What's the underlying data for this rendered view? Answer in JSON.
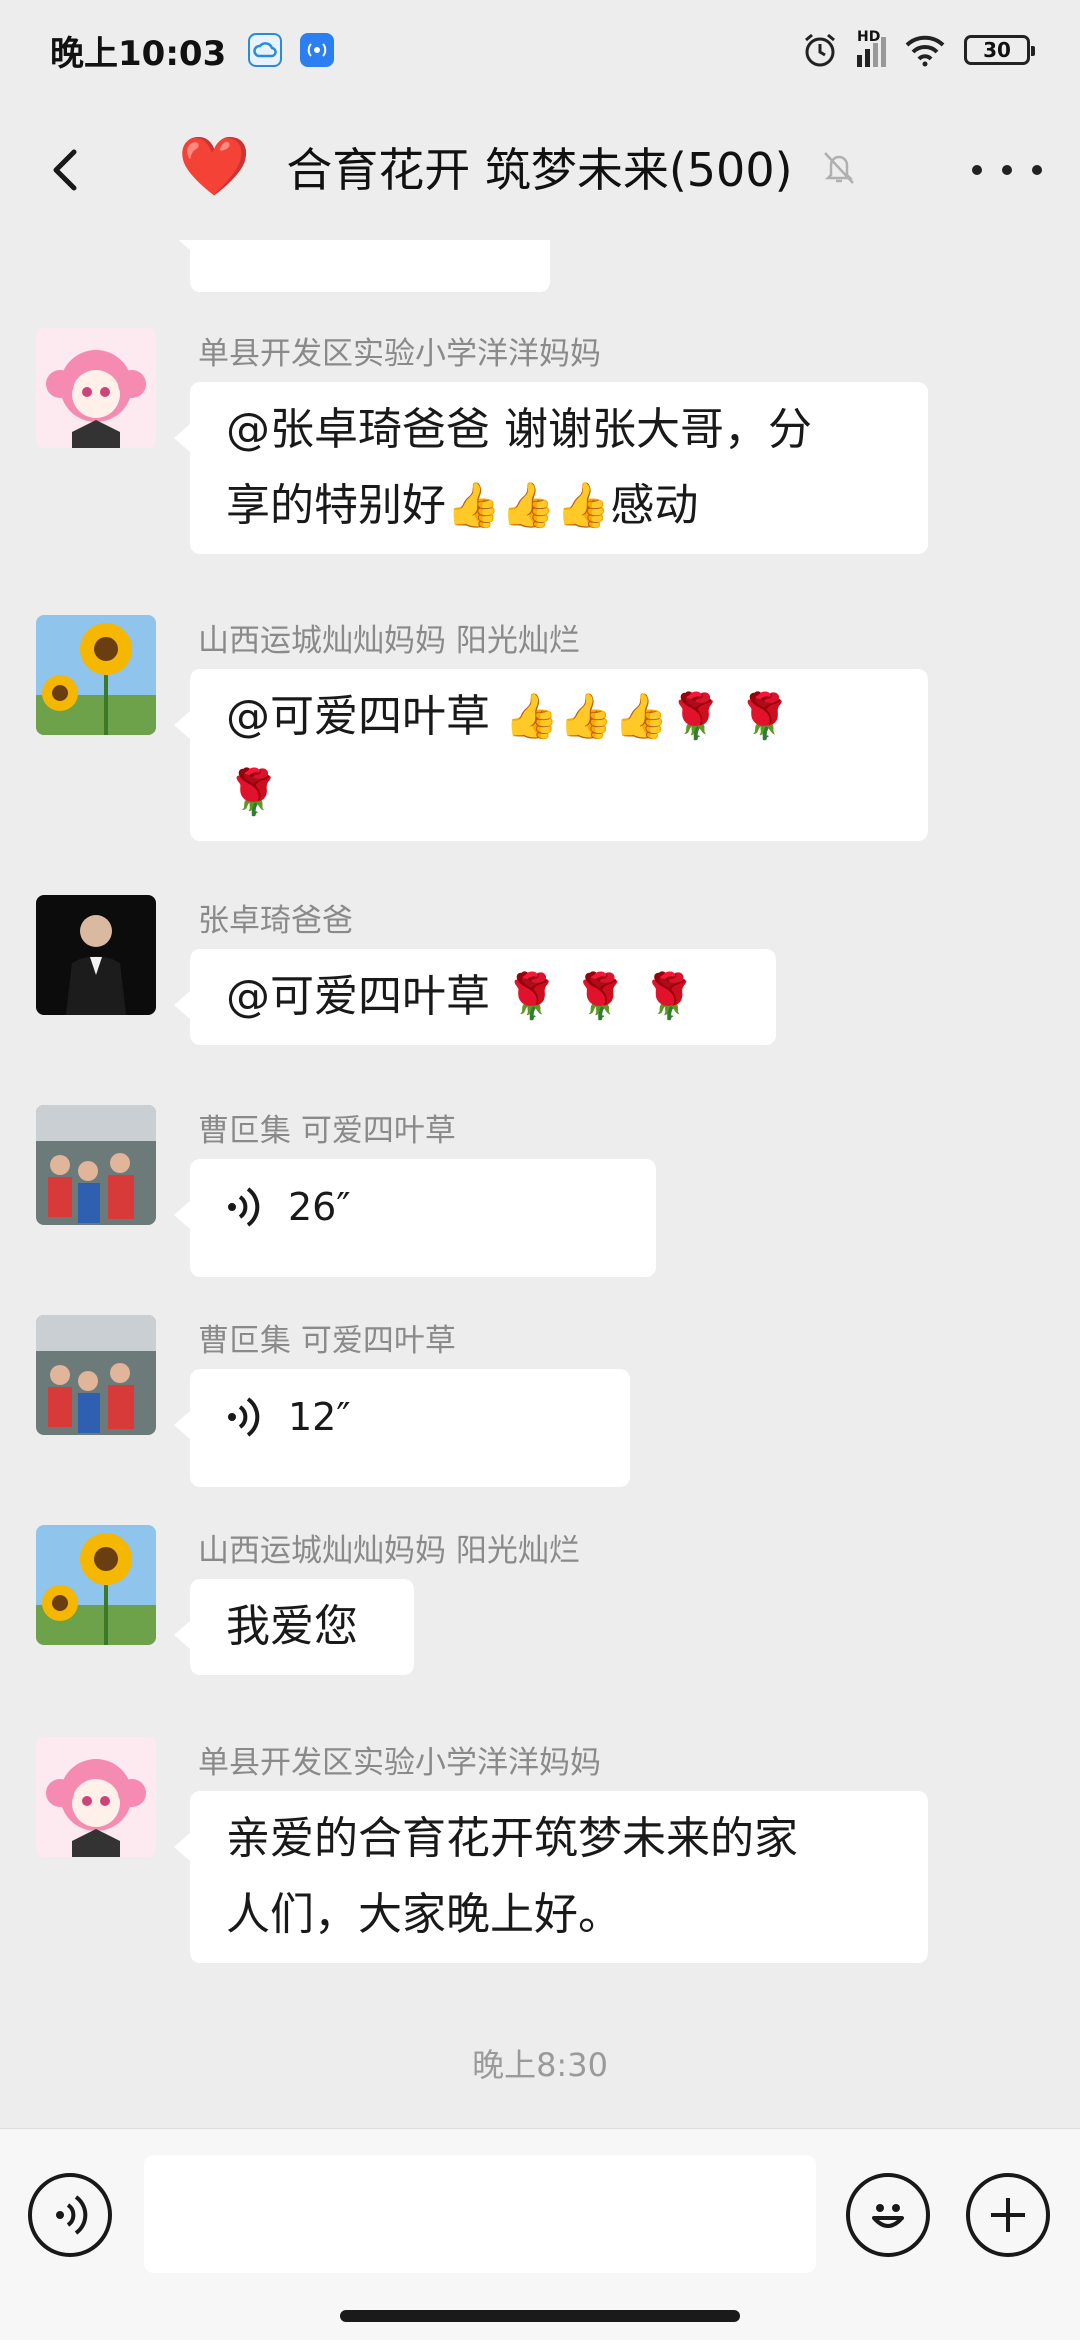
{
  "status_bar": {
    "time": "晚上10:03",
    "network_label": "HD",
    "battery": "30"
  },
  "header": {
    "title": "合育花开 筑梦未来(500)",
    "heart": "❤️",
    "back_icon": "chevron-left-icon",
    "mute_icon": "bell-off-icon",
    "more_icon": "more-horizontal-icon"
  },
  "messages": [
    {
      "sender": "单县开发区实验小学洋洋妈妈",
      "line1": "@张卓琦爸爸  谢谢张大哥，分",
      "line2": "享的特别好👍👍👍感动"
    },
    {
      "sender": "山西运城灿灿妈妈  阳光灿烂",
      "line1": "@可爱四叶草 👍👍👍🌹 🌹",
      "line2": "🌹"
    },
    {
      "sender": "张卓琦爸爸",
      "line1": "@可爱四叶草 🌹 🌹 🌹"
    },
    {
      "sender": "曹叵集 可爱四叶草",
      "voice": "26″"
    },
    {
      "sender": "曹叵集 可爱四叶草",
      "voice": "12″"
    },
    {
      "sender": "山西运城灿灿妈妈  阳光灿烂",
      "line1": "我爱您"
    },
    {
      "sender": "单县开发区实验小学洋洋妈妈",
      "line1": "亲爱的合育花开筑梦未来的家",
      "line2": "人们，大家晚上好。"
    }
  ],
  "time_separator": "晚上8:30",
  "input_bar": {
    "voice_icon": "voice-icon",
    "emoji_icon": "emoji-icon",
    "plus_icon": "plus-icon",
    "input_value": ""
  },
  "colors": {
    "background": "#ededed",
    "bubble": "#ffffff",
    "heart": "#e5222d",
    "sender_text": "#8a8a8a"
  }
}
